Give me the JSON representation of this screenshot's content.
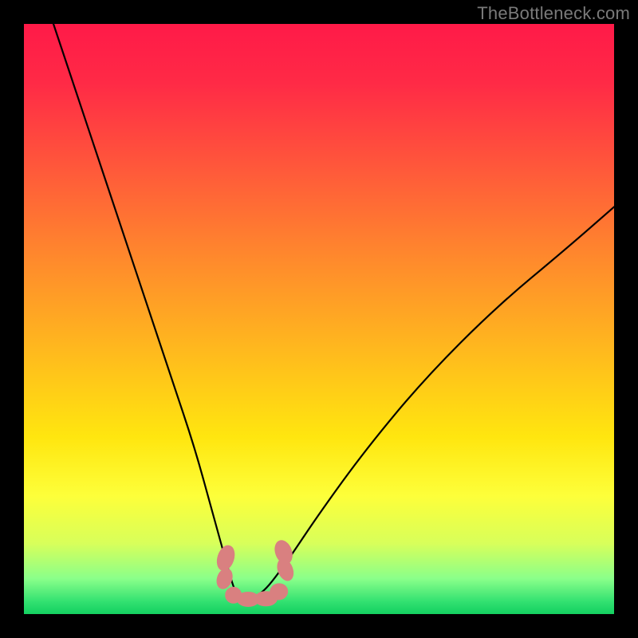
{
  "watermark": "TheBottleneck.com",
  "chart_data": {
    "type": "line",
    "title": "",
    "xlabel": "",
    "ylabel": "",
    "xlim": [
      0,
      100
    ],
    "ylim": [
      0,
      100
    ],
    "legend": false,
    "grid": false,
    "series": [
      {
        "name": "bottleneck-curve",
        "x": [
          5,
          9,
          13,
          17,
          21,
          25,
          29,
          32,
          34.5,
          36,
          37.5,
          40,
          44,
          50,
          58,
          68,
          80,
          92,
          100
        ],
        "y": [
          100,
          88,
          76,
          64,
          52,
          40,
          28,
          17,
          8,
          3,
          3,
          3,
          8,
          17,
          28,
          40,
          52,
          62,
          69
        ]
      }
    ],
    "annotations": [
      {
        "kind": "marker-blob",
        "shape": "caterpillar",
        "approx_x_range": [
          33,
          45
        ],
        "approx_y_range": [
          1,
          12
        ],
        "color": "#d98080"
      }
    ],
    "background": {
      "type": "vertical-gradient",
      "stops": [
        {
          "pos": 0.0,
          "color": "#ff1a48"
        },
        {
          "pos": 0.25,
          "color": "#ff5a3a"
        },
        {
          "pos": 0.55,
          "color": "#ffb81e"
        },
        {
          "pos": 0.8,
          "color": "#fdff3a"
        },
        {
          "pos": 0.94,
          "color": "#8aff8a"
        },
        {
          "pos": 1.0,
          "color": "#14d060"
        }
      ]
    }
  }
}
